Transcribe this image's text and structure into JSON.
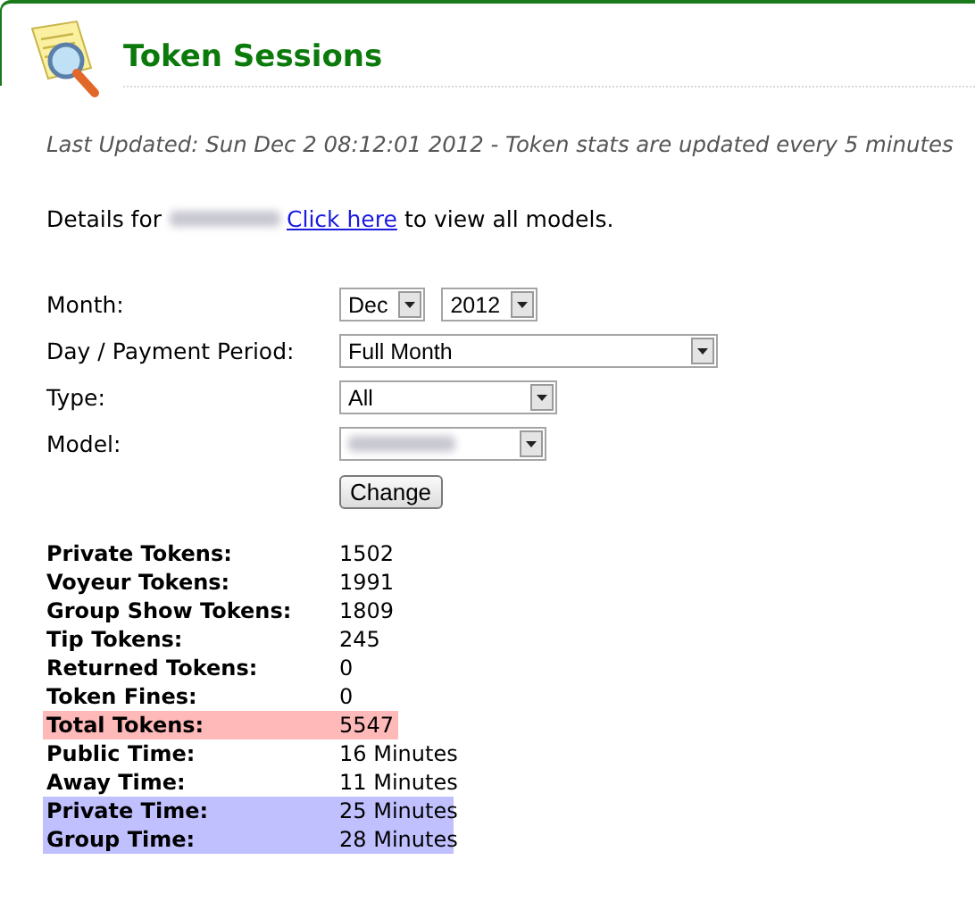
{
  "header": {
    "title": "Token Sessions"
  },
  "last_updated": "Last Updated: Sun Dec 2 08:12:01 2012 - Token stats are updated every 5 minutes",
  "details": {
    "prefix": "Details for",
    "link": "Click here",
    "suffix": "to view all models."
  },
  "form": {
    "fields": [
      {
        "label": "Month:",
        "selects": [
          {
            "value": "Dec"
          },
          {
            "value": "2012"
          }
        ]
      },
      {
        "label": "Day / Payment Period:",
        "selects": [
          {
            "value": "Full Month"
          }
        ]
      },
      {
        "label": "Type:",
        "selects": [
          {
            "value": "All"
          }
        ]
      },
      {
        "label": "Model:",
        "selects": [
          {
            "redacted": true
          }
        ]
      }
    ],
    "button": "Change"
  },
  "stats": [
    {
      "label": "Private Tokens:",
      "value": "1502"
    },
    {
      "label": "Voyeur Tokens:",
      "value": "1991"
    },
    {
      "label": "Group Show Tokens:",
      "value": "1809"
    },
    {
      "label": "Tip Tokens:",
      "value": "245"
    },
    {
      "label": "Returned Tokens:",
      "value": "0"
    },
    {
      "label": "Token Fines:",
      "value": "0"
    },
    {
      "label": "Total Tokens:",
      "value": "5547",
      "color": "#ffb9b9"
    },
    {
      "label": "Public Time:",
      "value": "16 Minutes"
    },
    {
      "label": "Away Time:",
      "value": "11 Minutes"
    },
    {
      "label": "Private Time:",
      "value": "25 Minutes",
      "color": "#c0c0ff"
    },
    {
      "label": "Group Time:",
      "value": "28 Minutes",
      "color": "#c0c0ff"
    }
  ]
}
